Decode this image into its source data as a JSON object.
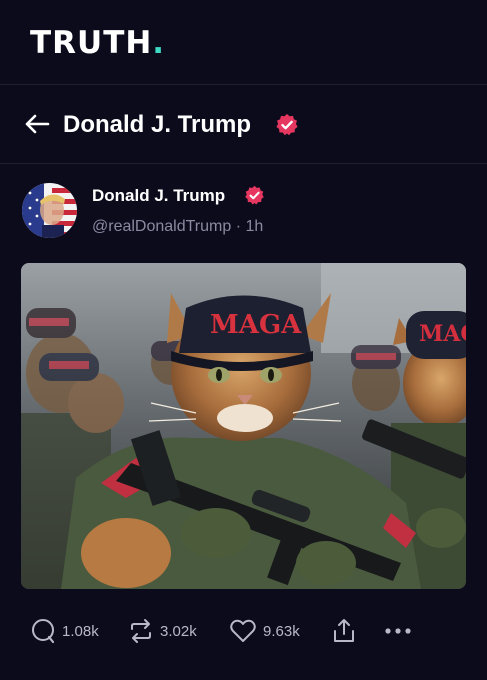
{
  "brand": {
    "logo_text": "TRUTH",
    "logo_dot": ".",
    "accent_color": "#3dd9c3"
  },
  "header": {
    "title": "Donald J. Trump",
    "back_icon": "arrow-left-icon",
    "verified_icon": "verified-badge-icon"
  },
  "post": {
    "author_name": "Donald J. Trump",
    "handle": "@realDonaldTrump",
    "separator": "·",
    "time": "1h",
    "image_cap_text": "MAGA",
    "actions": {
      "replies": "1.08k",
      "retruths": "3.02k",
      "likes": "9.63k"
    }
  },
  "colors": {
    "background": "#0c0b1c",
    "verified": "#e5375f",
    "muted_text": "#8a8aa0"
  }
}
